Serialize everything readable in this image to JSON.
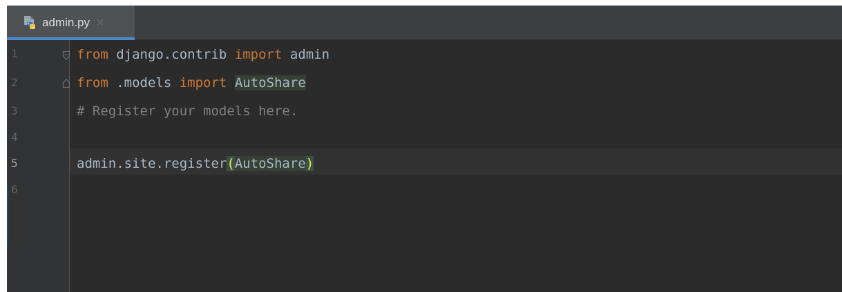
{
  "tab": {
    "icon": "python-file-icon",
    "title": "admin.py",
    "close": "×",
    "accent": "#4a88c7"
  },
  "editor": {
    "current_line": 5,
    "colors": {
      "background": "#2b2b2b",
      "gutter": "#313335",
      "keyword": "#cc7832",
      "text": "#a9b7c6",
      "comment": "#808080",
      "brace_match": "#ffef28"
    },
    "line_numbers": [
      "1",
      "2",
      "3",
      "4",
      "5",
      "6"
    ],
    "lines": [
      {
        "kw1": "from",
        "mod": " django.contrib ",
        "kw2": "import",
        "name": " admin"
      },
      {
        "kw1": "from",
        "mod": " .models ",
        "kw2": "import",
        "name": "AutoShare"
      },
      {
        "comment": "# Register your models here."
      },
      {},
      {
        "prefix": "admin.site.register",
        "open": "(",
        "arg": "AutoShare",
        "close": ")"
      },
      {}
    ]
  }
}
